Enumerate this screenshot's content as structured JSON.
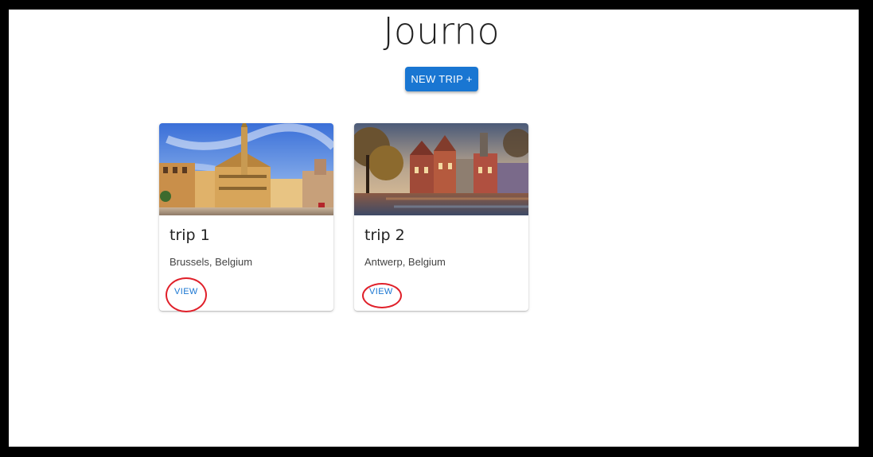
{
  "app": {
    "title": "Journo"
  },
  "toolbar": {
    "new_trip_label": "NEW TRIP +"
  },
  "trips": [
    {
      "title": "trip 1",
      "location": "Brussels, Belgium",
      "action_label": "VIEW",
      "image_icon": "brussels-grand-place-photo"
    },
    {
      "title": "trip 2",
      "location": "Antwerp, Belgium",
      "action_label": "VIEW",
      "image_icon": "canal-town-photo"
    }
  ],
  "colors": {
    "primary": "#1976d2",
    "annotation": "#e0202a"
  }
}
